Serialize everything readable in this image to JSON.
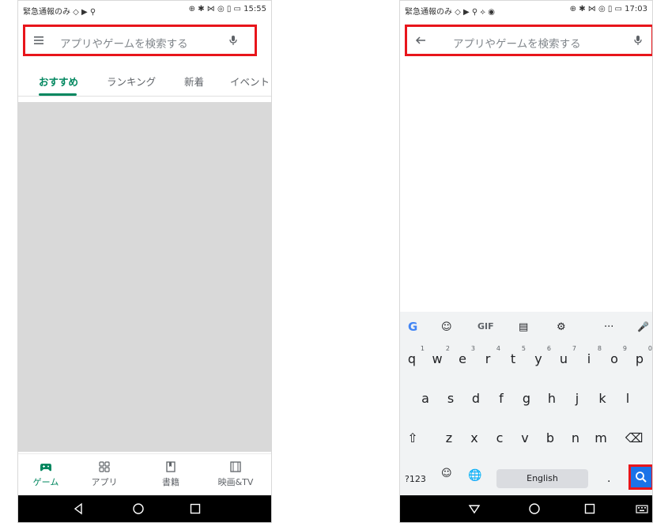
{
  "left_phone": {
    "status": {
      "left": "緊急通報のみ ◇ ▶ ⚲",
      "right": "⊕ ✱ ⋈ ◎ ▯ ▭ 15:55"
    },
    "search": {
      "placeholder": "アプリやゲームを検索する",
      "menu_icon": "hamburger-icon",
      "mic_icon": "mic-icon"
    },
    "tabs": [
      "おすすめ",
      "ランキング",
      "新着",
      "イベント"
    ],
    "bottom_nav": [
      {
        "label": "ゲーム",
        "icon": "gamepad-icon"
      },
      {
        "label": "アプリ",
        "icon": "apps-grid-icon"
      },
      {
        "label": "書籍",
        "icon": "book-icon"
      },
      {
        "label": "映画&TV",
        "icon": "film-icon"
      }
    ],
    "system_nav": [
      "back-icon",
      "home-icon",
      "recents-icon"
    ]
  },
  "right_phone": {
    "status": {
      "left": "緊急通報のみ ◇ ▶ ⚲ ⟡ ◉",
      "right": "⊕ ✱ ⋈ ◎ ▯ ▭ 17:03"
    },
    "search": {
      "placeholder": "アプリやゲームを検索する",
      "back_icon": "back-arrow-icon",
      "mic_icon": "mic-icon"
    },
    "keyboard": {
      "toolbar": [
        "G",
        "☺",
        "GIF",
        "▤",
        "⚙",
        "···",
        "🎤"
      ],
      "row1": [
        {
          "k": "q",
          "n": "1"
        },
        {
          "k": "w",
          "n": "2"
        },
        {
          "k": "e",
          "n": "3"
        },
        {
          "k": "r",
          "n": "4"
        },
        {
          "k": "t",
          "n": "5"
        },
        {
          "k": "y",
          "n": "6"
        },
        {
          "k": "u",
          "n": "7"
        },
        {
          "k": "i",
          "n": "8"
        },
        {
          "k": "o",
          "n": "9"
        },
        {
          "k": "p",
          "n": "0"
        }
      ],
      "row2": [
        "a",
        "s",
        "d",
        "f",
        "g",
        "h",
        "j",
        "k",
        "l"
      ],
      "row3": [
        "⇧",
        "z",
        "x",
        "c",
        "v",
        "b",
        "n",
        "m",
        "⌫"
      ],
      "row4": {
        "mode": "?123",
        "emoji": "☺",
        "globe": "🌐",
        "space": "English",
        "period": "."
      }
    },
    "system_nav": [
      "down-triangle-icon",
      "home-icon",
      "recents-icon",
      "keyboard-icon"
    ]
  },
  "colors": {
    "highlight": "#e8151b",
    "play_green": "#01875f",
    "search_key": "#1a73e8"
  }
}
